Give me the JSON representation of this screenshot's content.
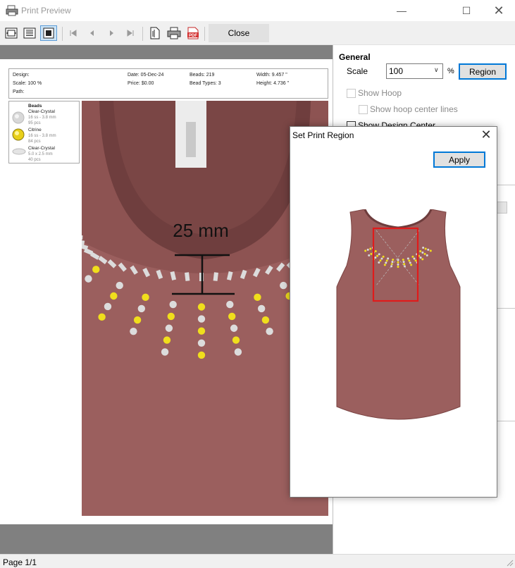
{
  "window": {
    "title": "Print Preview",
    "minimize": "—",
    "maximize": "☐",
    "close": "✕"
  },
  "toolbar": {
    "close_label": "Close",
    "pdf_label": "PDF"
  },
  "preview": {
    "info": {
      "design": "Design:",
      "scale": "Scale: 100 %",
      "path": "Path:",
      "date": "Date: 05-Dec-24",
      "price": "Price: $0.00",
      "beads": "Beads: 219",
      "bead_types": "Bead Types: 3",
      "width": "Width: 9.457 \"",
      "height": "Height: 4.736 \""
    },
    "legend": {
      "heading": "Beads",
      "items": [
        {
          "name": "Clear-Crystal",
          "size": "16 ss - 3.8 mm",
          "count": "95 pcs"
        },
        {
          "name": "Citrine",
          "size": "16 ss - 3.8 mm",
          "count": "84 pcs"
        },
        {
          "name": "Clear-Crystal",
          "size": "5.0 x 2.5 mm",
          "count": "40 pcs"
        }
      ]
    },
    "measure_label": "25 mm"
  },
  "panel": {
    "general_heading": "General",
    "scale_label": "Scale",
    "scale_value": "100",
    "percent": "%",
    "region_button": "Region",
    "show_hoop": "Show Hoop",
    "show_hoop_center": "Show hoop center lines",
    "show_design_center": "Show Design Center"
  },
  "dialog": {
    "title": "Set Print Region",
    "close": "✕",
    "apply_button": "Apply"
  },
  "status": {
    "page": "Page 1/1"
  },
  "colors": {
    "accent": "#0078d7",
    "shirt": "#9b5f5e",
    "citrine": "#f0de1c",
    "crystal": "#dcdcdc",
    "region_outline": "#e01b1b"
  },
  "icons": [
    "print-preview-app-icon",
    "fit-page-icon",
    "fit-width-icon",
    "actual-size-icon",
    "first-page-icon",
    "previous-page-icon",
    "next-page-icon",
    "last-page-icon",
    "page-setup-icon",
    "printer-icon",
    "pdf-icon"
  ]
}
